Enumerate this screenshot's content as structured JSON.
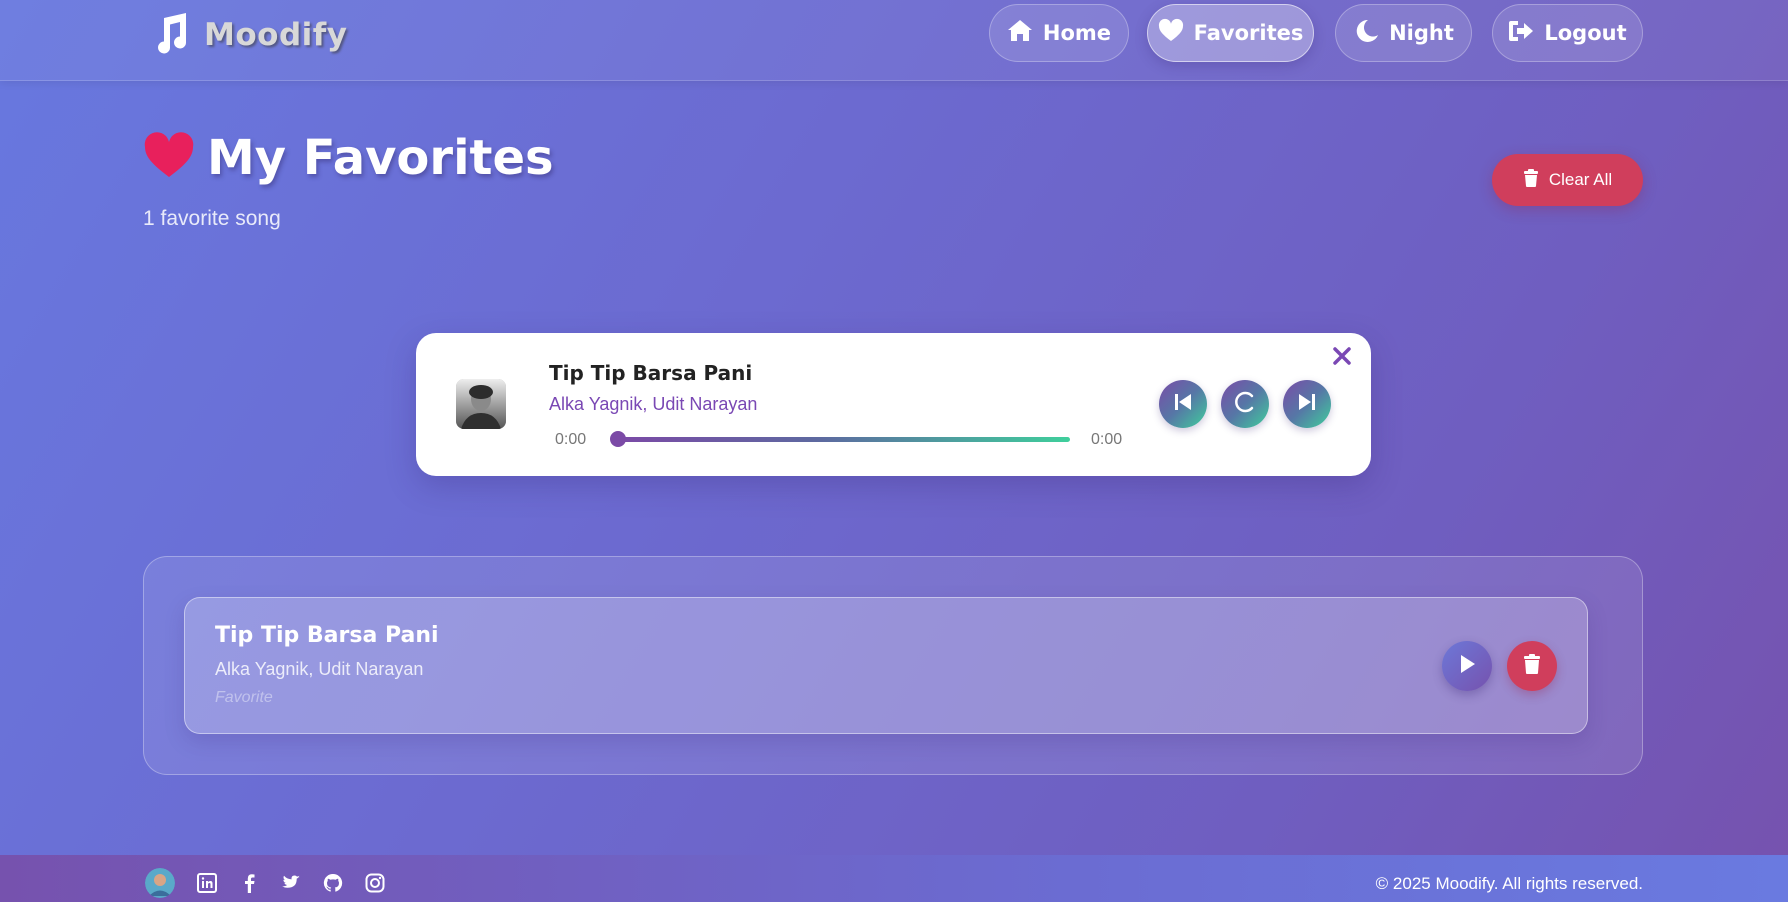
{
  "brand": {
    "name": "Moodify"
  },
  "nav": {
    "home": "Home",
    "favorites": "Favorites",
    "night": "Night",
    "logout": "Logout"
  },
  "header": {
    "title": "My Favorites",
    "subtitle": "1 favorite song",
    "clear_all": "Clear All"
  },
  "player": {
    "title": "Tip Tip Barsa Pani",
    "artist": "Alka Yagnik, Udit Narayan",
    "current_time": "0:00",
    "duration": "0:00",
    "progress": 0
  },
  "favorites": [
    {
      "title": "Tip Tip Barsa Pani",
      "artist": "Alka Yagnik, Udit Narayan",
      "tag": "Favorite"
    }
  ],
  "footer": {
    "copyright": "© 2025 Moodify. All rights reserved.",
    "social_icons": [
      "avatar",
      "linkedin-icon",
      "facebook-icon",
      "twitter-icon",
      "github-icon",
      "instagram-icon"
    ]
  },
  "colors": {
    "accent_red": "#d03e5c",
    "heart_pink": "#e8205c",
    "player_purple": "#7a48b4",
    "progress_end": "#3fcf9c"
  }
}
